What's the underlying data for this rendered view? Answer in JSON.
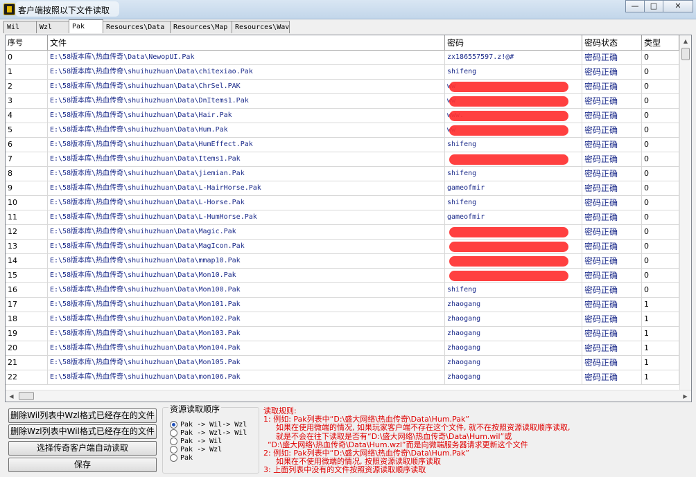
{
  "window": {
    "title": "客户端按照以下文件读取",
    "buttons": [
      "—",
      "□",
      "✕"
    ]
  },
  "tabs": [
    "Wil",
    "Wzl",
    "Pak",
    "Resources\\Data",
    "Resources\\Map",
    "Resources\\Wav"
  ],
  "active_tab": "Pak",
  "grid": {
    "columns": [
      "序号",
      "文件",
      "密码",
      "密码状态",
      "类型"
    ],
    "rows": [
      {
        "idx": "0",
        "file": "E:\\58版本库\\热血传奇\\Data\\NewopUI.Pak",
        "pwd": "zx186557597.z!@#",
        "state": "密码正确",
        "type": "0",
        "redacted": false
      },
      {
        "idx": "1",
        "file": "E:\\58版本库\\热血传奇\\shuihuzhuan\\Data\\chitexiao.Pak",
        "pwd": "shifeng",
        "state": "密码正确",
        "type": "0",
        "redacted": false
      },
      {
        "idx": "2",
        "file": "E:\\58版本库\\热血传奇\\shuihuzhuan\\Data\\ChrSel.PAK",
        "pwd": "ww",
        "state": "密码正确",
        "type": "0",
        "redacted": true
      },
      {
        "idx": "3",
        "file": "E:\\58版本库\\热血传奇\\shuihuzhuan\\Data\\DnItems1.Pak",
        "pwd": "ww",
        "state": "密码正确",
        "type": "0",
        "redacted": true
      },
      {
        "idx": "4",
        "file": "E:\\58版本库\\热血传奇\\shuihuzhuan\\Data\\Hair.Pak",
        "pwd": "www.",
        "state": "密码正确",
        "type": "0",
        "redacted": true
      },
      {
        "idx": "5",
        "file": "E:\\58版本库\\热血传奇\\shuihuzhuan\\Data\\Hum.Pak",
        "pwd": "ww",
        "state": "密码正确",
        "type": "0",
        "redacted": true
      },
      {
        "idx": "6",
        "file": "E:\\58版本库\\热血传奇\\shuihuzhuan\\Data\\HumEffect.Pak",
        "pwd": "shifeng",
        "state": "密码正确",
        "type": "0",
        "redacted": false
      },
      {
        "idx": "7",
        "file": "E:\\58版本库\\热血传奇\\shuihuzhuan\\Data\\Items1.Pak",
        "pwd": "",
        "state": "密码正确",
        "type": "0",
        "redacted": true
      },
      {
        "idx": "8",
        "file": "E:\\58版本库\\热血传奇\\shuihuzhuan\\Data\\jiemian.Pak",
        "pwd": "shifeng",
        "state": "密码正确",
        "type": "0",
        "redacted": false
      },
      {
        "idx": "9",
        "file": "E:\\58版本库\\热血传奇\\shuihuzhuan\\Data\\L-HairHorse.Pak",
        "pwd": "gameofmir",
        "state": "密码正确",
        "type": "0",
        "redacted": false
      },
      {
        "idx": "10",
        "file": "E:\\58版本库\\热血传奇\\shuihuzhuan\\Data\\L-Horse.Pak",
        "pwd": "shifeng",
        "state": "密码正确",
        "type": "0",
        "redacted": false
      },
      {
        "idx": "11",
        "file": "E:\\58版本库\\热血传奇\\shuihuzhuan\\Data\\L-HumHorse.Pak",
        "pwd": "gameofmir",
        "state": "密码正确",
        "type": "0",
        "redacted": false
      },
      {
        "idx": "12",
        "file": "E:\\58版本库\\热血传奇\\shuihuzhuan\\Data\\Magic.Pak",
        "pwd": "",
        "state": "密码正确",
        "type": "0",
        "redacted": true
      },
      {
        "idx": "13",
        "file": "E:\\58版本库\\热血传奇\\shuihuzhuan\\Data\\MagIcon.Pak",
        "pwd": "",
        "state": "密码正确",
        "type": "0",
        "redacted": true
      },
      {
        "idx": "14",
        "file": "E:\\58版本库\\热血传奇\\shuihuzhuan\\Data\\mmap10.Pak",
        "pwd": "",
        "state": "密码正确",
        "type": "0",
        "redacted": true
      },
      {
        "idx": "15",
        "file": "E:\\58版本库\\热血传奇\\shuihuzhuan\\Data\\Mon10.Pak",
        "pwd": "",
        "state": "密码正确",
        "type": "0",
        "redacted": true
      },
      {
        "idx": "16",
        "file": "E:\\58版本库\\热血传奇\\shuihuzhuan\\Data\\Mon100.Pak",
        "pwd": "shifeng",
        "state": "密码正确",
        "type": "0",
        "redacted": false
      },
      {
        "idx": "17",
        "file": "E:\\58版本库\\热血传奇\\shuihuzhuan\\Data\\Mon101.Pak",
        "pwd": "zhaogang",
        "state": "密码正确",
        "type": "1",
        "redacted": false
      },
      {
        "idx": "18",
        "file": "E:\\58版本库\\热血传奇\\shuihuzhuan\\Data\\Mon102.Pak",
        "pwd": "zhaogang",
        "state": "密码正确",
        "type": "1",
        "redacted": false
      },
      {
        "idx": "19",
        "file": "E:\\58版本库\\热血传奇\\shuihuzhuan\\Data\\Mon103.Pak",
        "pwd": "zhaogang",
        "state": "密码正确",
        "type": "1",
        "redacted": false
      },
      {
        "idx": "20",
        "file": "E:\\58版本库\\热血传奇\\shuihuzhuan\\Data\\Mon104.Pak",
        "pwd": "zhaogang",
        "state": "密码正确",
        "type": "1",
        "redacted": false
      },
      {
        "idx": "21",
        "file": "E:\\58版本库\\热血传奇\\shuihuzhuan\\Data\\Mon105.Pak",
        "pwd": "zhaogang",
        "state": "密码正确",
        "type": "1",
        "redacted": false
      },
      {
        "idx": "22",
        "file": "E:\\58版本库\\热血传奇\\shuihuzhuan\\Data\\mon106.Pak",
        "pwd": "zhaogang",
        "state": "密码正确",
        "type": "1",
        "redacted": false
      }
    ]
  },
  "buttons": {
    "delete_wil": "删除Wil列表中Wzl格式已经存在的文件",
    "delete_wzl": "删除Wzl列表中Wil格式已经存在的文件",
    "auto_read": "选择传奇客户端自动读取",
    "save": "保存"
  },
  "read_order": {
    "title": "资源读取顺序",
    "options": [
      "Pak -> Wil-> Wzl",
      "Pak -> Wzl-> Wil",
      "Pak -> Wil",
      "Pak -> Wzl",
      "Pak"
    ],
    "selected_index": 0
  },
  "notes": [
    "读取规则:",
    "1: 例如: Pak列表中“D:\\盛大网络\\热血传奇\\Data\\Hum.Pak”",
    "如果在使用微端的情况, 如果玩家客户端不存在这个文件, 就不在按照资源读取顺序读取,",
    "就是不会在往下读取是否有“D:\\盛大网络\\热血传奇\\Data\\Hum.wil”或",
    "“D:\\盛大网络\\热血传奇\\Data\\Hum.wzl”而是向微端服务器请求更新这个文件",
    "2: 例如: Pak列表中“D:\\盛大网络\\热血传奇\\Data\\Hum.Pak”",
    "如果在不使用微端的情况, 按照资源读取顺序读取",
    "3: 上面列表中没有的文件按照资源读取顺序读取"
  ],
  "icons": {
    "app": "app-icon",
    "scroll_up": "▲",
    "scroll_left": "◀",
    "scroll_right": "▶"
  }
}
